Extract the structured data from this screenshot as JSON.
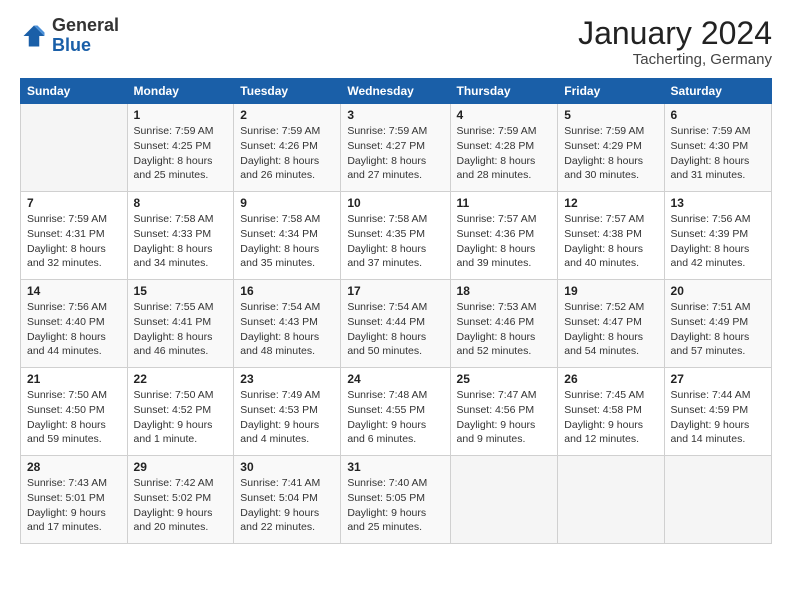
{
  "logo": {
    "general": "General",
    "blue": "Blue"
  },
  "title": "January 2024",
  "subtitle": "Tacherting, Germany",
  "weekdays": [
    "Sunday",
    "Monday",
    "Tuesday",
    "Wednesday",
    "Thursday",
    "Friday",
    "Saturday"
  ],
  "weeks": [
    [
      {
        "day": "",
        "sunrise": "",
        "sunset": "",
        "daylight": ""
      },
      {
        "day": "1",
        "sunrise": "Sunrise: 7:59 AM",
        "sunset": "Sunset: 4:25 PM",
        "daylight": "Daylight: 8 hours and 25 minutes."
      },
      {
        "day": "2",
        "sunrise": "Sunrise: 7:59 AM",
        "sunset": "Sunset: 4:26 PM",
        "daylight": "Daylight: 8 hours and 26 minutes."
      },
      {
        "day": "3",
        "sunrise": "Sunrise: 7:59 AM",
        "sunset": "Sunset: 4:27 PM",
        "daylight": "Daylight: 8 hours and 27 minutes."
      },
      {
        "day": "4",
        "sunrise": "Sunrise: 7:59 AM",
        "sunset": "Sunset: 4:28 PM",
        "daylight": "Daylight: 8 hours and 28 minutes."
      },
      {
        "day": "5",
        "sunrise": "Sunrise: 7:59 AM",
        "sunset": "Sunset: 4:29 PM",
        "daylight": "Daylight: 8 hours and 30 minutes."
      },
      {
        "day": "6",
        "sunrise": "Sunrise: 7:59 AM",
        "sunset": "Sunset: 4:30 PM",
        "daylight": "Daylight: 8 hours and 31 minutes."
      }
    ],
    [
      {
        "day": "7",
        "sunrise": "Sunrise: 7:59 AM",
        "sunset": "Sunset: 4:31 PM",
        "daylight": "Daylight: 8 hours and 32 minutes."
      },
      {
        "day": "8",
        "sunrise": "Sunrise: 7:58 AM",
        "sunset": "Sunset: 4:33 PM",
        "daylight": "Daylight: 8 hours and 34 minutes."
      },
      {
        "day": "9",
        "sunrise": "Sunrise: 7:58 AM",
        "sunset": "Sunset: 4:34 PM",
        "daylight": "Daylight: 8 hours and 35 minutes."
      },
      {
        "day": "10",
        "sunrise": "Sunrise: 7:58 AM",
        "sunset": "Sunset: 4:35 PM",
        "daylight": "Daylight: 8 hours and 37 minutes."
      },
      {
        "day": "11",
        "sunrise": "Sunrise: 7:57 AM",
        "sunset": "Sunset: 4:36 PM",
        "daylight": "Daylight: 8 hours and 39 minutes."
      },
      {
        "day": "12",
        "sunrise": "Sunrise: 7:57 AM",
        "sunset": "Sunset: 4:38 PM",
        "daylight": "Daylight: 8 hours and 40 minutes."
      },
      {
        "day": "13",
        "sunrise": "Sunrise: 7:56 AM",
        "sunset": "Sunset: 4:39 PM",
        "daylight": "Daylight: 8 hours and 42 minutes."
      }
    ],
    [
      {
        "day": "14",
        "sunrise": "Sunrise: 7:56 AM",
        "sunset": "Sunset: 4:40 PM",
        "daylight": "Daylight: 8 hours and 44 minutes."
      },
      {
        "day": "15",
        "sunrise": "Sunrise: 7:55 AM",
        "sunset": "Sunset: 4:41 PM",
        "daylight": "Daylight: 8 hours and 46 minutes."
      },
      {
        "day": "16",
        "sunrise": "Sunrise: 7:54 AM",
        "sunset": "Sunset: 4:43 PM",
        "daylight": "Daylight: 8 hours and 48 minutes."
      },
      {
        "day": "17",
        "sunrise": "Sunrise: 7:54 AM",
        "sunset": "Sunset: 4:44 PM",
        "daylight": "Daylight: 8 hours and 50 minutes."
      },
      {
        "day": "18",
        "sunrise": "Sunrise: 7:53 AM",
        "sunset": "Sunset: 4:46 PM",
        "daylight": "Daylight: 8 hours and 52 minutes."
      },
      {
        "day": "19",
        "sunrise": "Sunrise: 7:52 AM",
        "sunset": "Sunset: 4:47 PM",
        "daylight": "Daylight: 8 hours and 54 minutes."
      },
      {
        "day": "20",
        "sunrise": "Sunrise: 7:51 AM",
        "sunset": "Sunset: 4:49 PM",
        "daylight": "Daylight: 8 hours and 57 minutes."
      }
    ],
    [
      {
        "day": "21",
        "sunrise": "Sunrise: 7:50 AM",
        "sunset": "Sunset: 4:50 PM",
        "daylight": "Daylight: 8 hours and 59 minutes."
      },
      {
        "day": "22",
        "sunrise": "Sunrise: 7:50 AM",
        "sunset": "Sunset: 4:52 PM",
        "daylight": "Daylight: 9 hours and 1 minute."
      },
      {
        "day": "23",
        "sunrise": "Sunrise: 7:49 AM",
        "sunset": "Sunset: 4:53 PM",
        "daylight": "Daylight: 9 hours and 4 minutes."
      },
      {
        "day": "24",
        "sunrise": "Sunrise: 7:48 AM",
        "sunset": "Sunset: 4:55 PM",
        "daylight": "Daylight: 9 hours and 6 minutes."
      },
      {
        "day": "25",
        "sunrise": "Sunrise: 7:47 AM",
        "sunset": "Sunset: 4:56 PM",
        "daylight": "Daylight: 9 hours and 9 minutes."
      },
      {
        "day": "26",
        "sunrise": "Sunrise: 7:45 AM",
        "sunset": "Sunset: 4:58 PM",
        "daylight": "Daylight: 9 hours and 12 minutes."
      },
      {
        "day": "27",
        "sunrise": "Sunrise: 7:44 AM",
        "sunset": "Sunset: 4:59 PM",
        "daylight": "Daylight: 9 hours and 14 minutes."
      }
    ],
    [
      {
        "day": "28",
        "sunrise": "Sunrise: 7:43 AM",
        "sunset": "Sunset: 5:01 PM",
        "daylight": "Daylight: 9 hours and 17 minutes."
      },
      {
        "day": "29",
        "sunrise": "Sunrise: 7:42 AM",
        "sunset": "Sunset: 5:02 PM",
        "daylight": "Daylight: 9 hours and 20 minutes."
      },
      {
        "day": "30",
        "sunrise": "Sunrise: 7:41 AM",
        "sunset": "Sunset: 5:04 PM",
        "daylight": "Daylight: 9 hours and 22 minutes."
      },
      {
        "day": "31",
        "sunrise": "Sunrise: 7:40 AM",
        "sunset": "Sunset: 5:05 PM",
        "daylight": "Daylight: 9 hours and 25 minutes."
      },
      {
        "day": "",
        "sunrise": "",
        "sunset": "",
        "daylight": ""
      },
      {
        "day": "",
        "sunrise": "",
        "sunset": "",
        "daylight": ""
      },
      {
        "day": "",
        "sunrise": "",
        "sunset": "",
        "daylight": ""
      }
    ]
  ]
}
